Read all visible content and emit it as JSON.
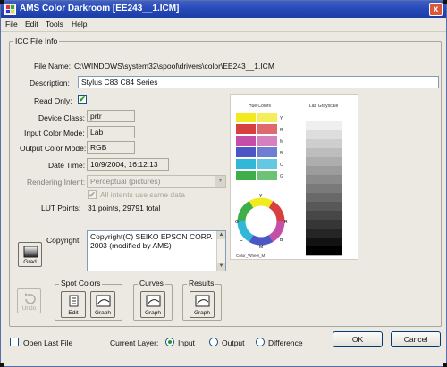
{
  "window": {
    "title": "AMS Color Darkroom [EE243__1.ICM]",
    "close_label": "x"
  },
  "menu": [
    "File",
    "Edit",
    "Tools",
    "Help"
  ],
  "group_title": "ICC File Info",
  "file_name": {
    "label": "File Name:",
    "value": "C:\\WINDOWS\\system32\\spool\\drivers\\color\\EE243__1.ICM"
  },
  "description": {
    "label": "Description:",
    "value": "Stylus C83 C84 Series"
  },
  "read_only": {
    "label": "Read Only:",
    "checked": true,
    "mark": "✔"
  },
  "device_class": {
    "label": "Device Class:",
    "value": "prtr"
  },
  "input_mode": {
    "label": "Input Color Mode:",
    "value": "Lab"
  },
  "output_mode": {
    "label": "Output Color Mode:",
    "value": "RGB"
  },
  "date_time": {
    "label": "Date Time:",
    "value": "10/9/2004, 16:12:13"
  },
  "rendering_intent": {
    "label": "Rendering Intent:",
    "value": "Perceptual (pictures)",
    "arrow": "▼"
  },
  "all_intents": {
    "label": "All intents use same data",
    "checked": true,
    "mark": "✔"
  },
  "lut_points": {
    "label": "LUT Points:",
    "value": "31 points, 29791 total"
  },
  "copyright": {
    "label": "Copyright:",
    "value": "Copyright(C) SEIKO EPSON CORP. 2003 (modified by AMS)"
  },
  "preview": {
    "colors_title": "Hue Colors",
    "gray_title": "Lab Grayscale",
    "swatches": [
      {
        "left": "#f2ea1f",
        "right": "#f5ee5a",
        "code": "Y"
      },
      {
        "left": "#d83f3f",
        "right": "#e0696e",
        "code": "R"
      },
      {
        "left": "#c54fa8",
        "right": "#d680c0",
        "code": "M"
      },
      {
        "left": "#4a57c4",
        "right": "#6f7dd2",
        "code": "B"
      },
      {
        "left": "#31b8d8",
        "right": "#63c9e2",
        "code": "C"
      },
      {
        "left": "#3fae4a",
        "right": "#6dc276",
        "code": "G"
      }
    ],
    "wheel_labels": {
      "top": "Y",
      "left": "G",
      "right": "R",
      "bottom": "M",
      "lower_left": "C",
      "lower_right": "B"
    },
    "wheel_caption": "Color_Wheel_M",
    "gray_colors": [
      "#ffffff",
      "#efefef",
      "#dedede",
      "#cecece",
      "#bdbdbd",
      "#adadad",
      "#9c9c9c",
      "#8b8b8b",
      "#7a7a7a",
      "#696969",
      "#585858",
      "#474747",
      "#363636",
      "#252525",
      "#121212",
      "#000000"
    ]
  },
  "grad_button": {
    "label": "Grad"
  },
  "undo_button": {
    "label": "Undo"
  },
  "spot_colors": {
    "title": "Spot Colors",
    "edit_label": "Edit",
    "graph_label": "Graph"
  },
  "curves": {
    "title": "Curves",
    "graph_label": "Graph"
  },
  "results": {
    "title": "Results",
    "graph_label": "Graph"
  },
  "open_last_file": {
    "label": "Open Last File",
    "checked": false
  },
  "current_layer": {
    "label": "Current Layer:",
    "options": [
      {
        "label": "Input",
        "selected": true
      },
      {
        "label": "Output",
        "selected": false
      },
      {
        "label": "Difference",
        "selected": false
      }
    ]
  },
  "ok_label": "OK",
  "cancel_label": "Cancel"
}
